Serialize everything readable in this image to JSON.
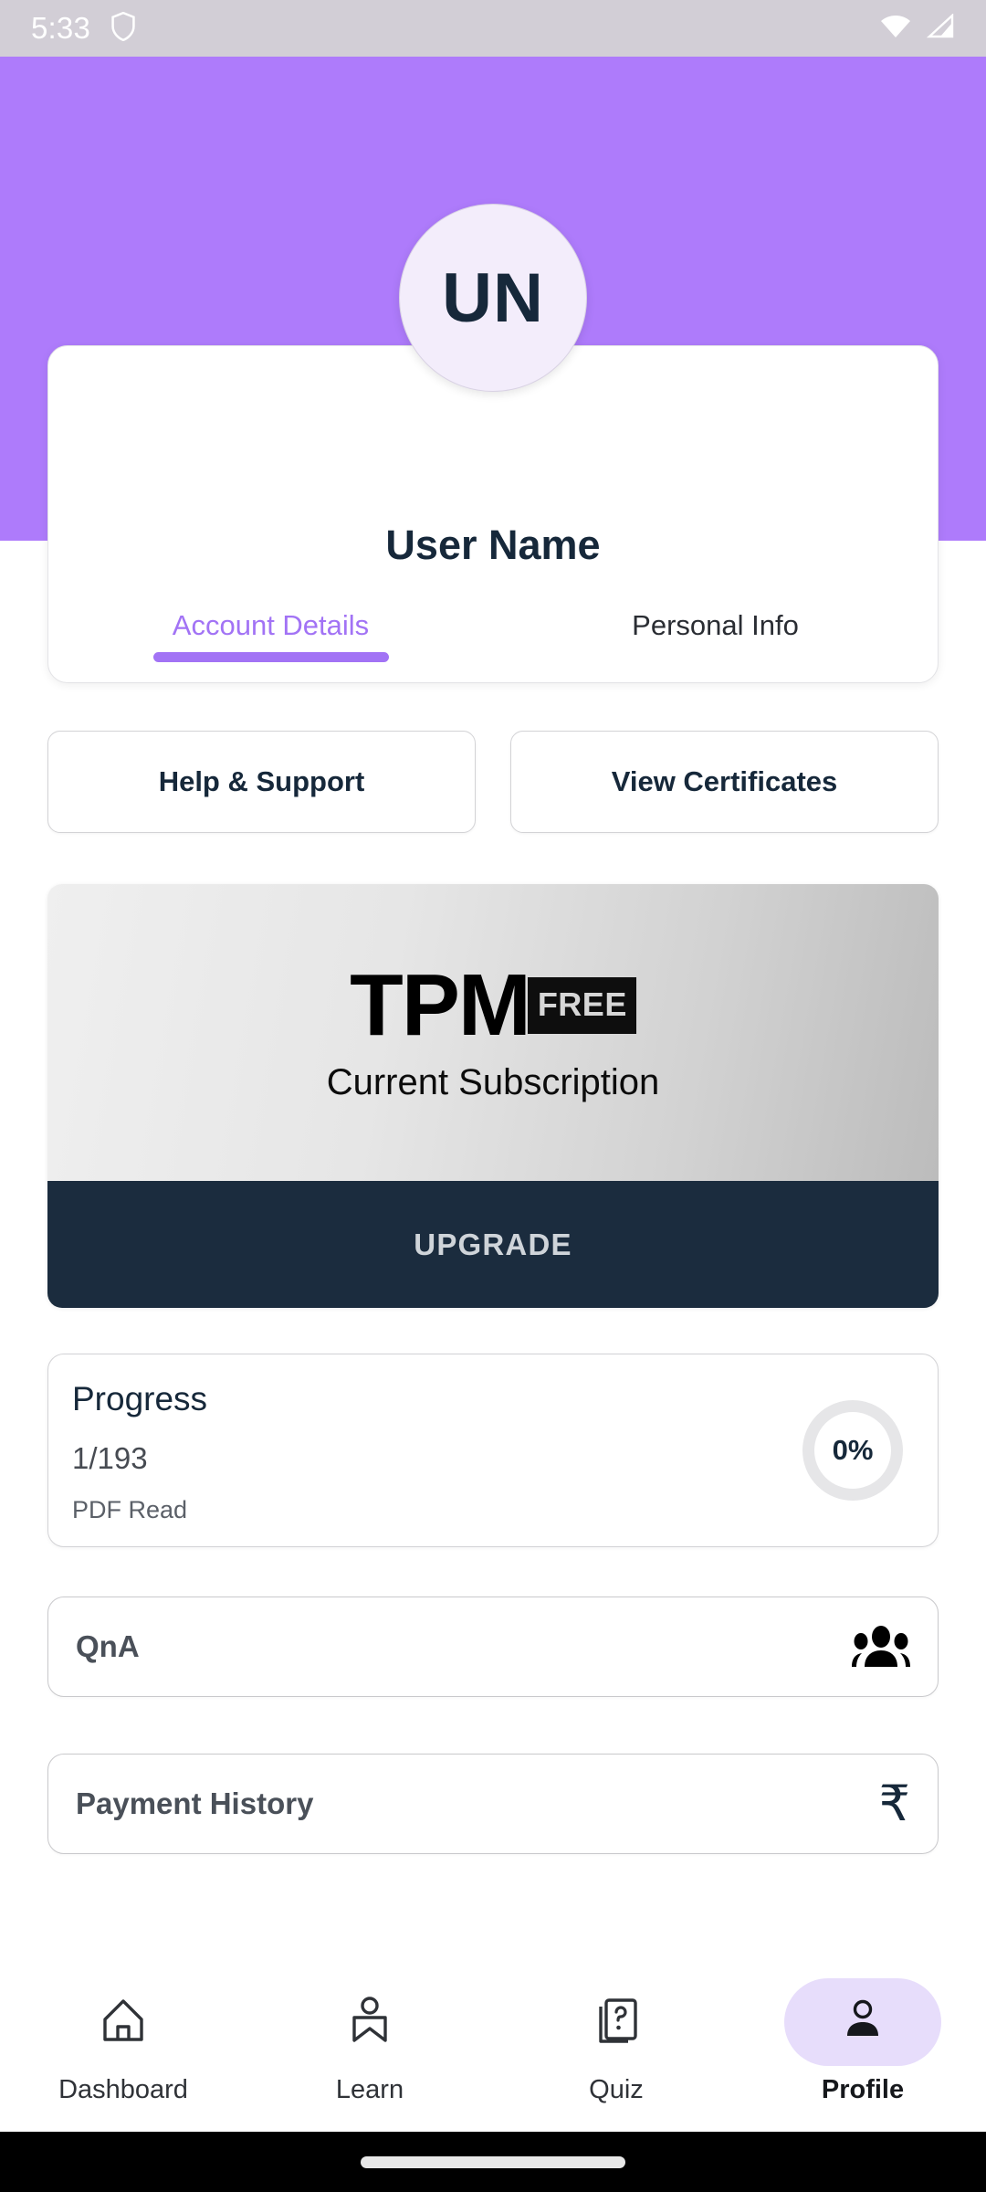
{
  "status_bar": {
    "time": "5:33",
    "icons": [
      "shield-icon",
      "wifi-icon",
      "cellular-signal-icon"
    ]
  },
  "theme": {
    "accent_purple": "#AE7BFB",
    "tab_active_purple": "#A273F5",
    "dark_navy": "#16283A",
    "upgrade_bg": "#1B2C3E",
    "nav_active_pill": "#E7DDFB",
    "status_bar_bg": "#D2CED6",
    "avatar_bg": "#F3EDFB"
  },
  "profile": {
    "avatar_initials": "UN",
    "user_name": "User Name",
    "tabs": [
      {
        "label": "Account Details",
        "active": true
      },
      {
        "label": "Personal Info",
        "active": false
      }
    ]
  },
  "actions": {
    "help_support": "Help & Support",
    "view_certificates": "View Certificates"
  },
  "subscription": {
    "brand": "TPM",
    "plan_badge": "FREE",
    "caption": "Current Subscription",
    "upgrade_label": "UPGRADE"
  },
  "progress": {
    "title": "Progress",
    "count": "1/193",
    "subtitle": "PDF Read",
    "percent_label": "0%",
    "percent_value": 0
  },
  "list_rows": [
    {
      "label": "QnA",
      "icon": "people-group-icon"
    },
    {
      "label": "Payment History",
      "icon": "rupee-icon"
    }
  ],
  "bottom_nav": [
    {
      "label": "Dashboard",
      "icon": "home-icon",
      "active": false
    },
    {
      "label": "Learn",
      "icon": "bookmark-person-icon",
      "active": false
    },
    {
      "label": "Quiz",
      "icon": "question-card-icon",
      "active": false
    },
    {
      "label": "Profile",
      "icon": "person-icon",
      "active": true
    }
  ]
}
